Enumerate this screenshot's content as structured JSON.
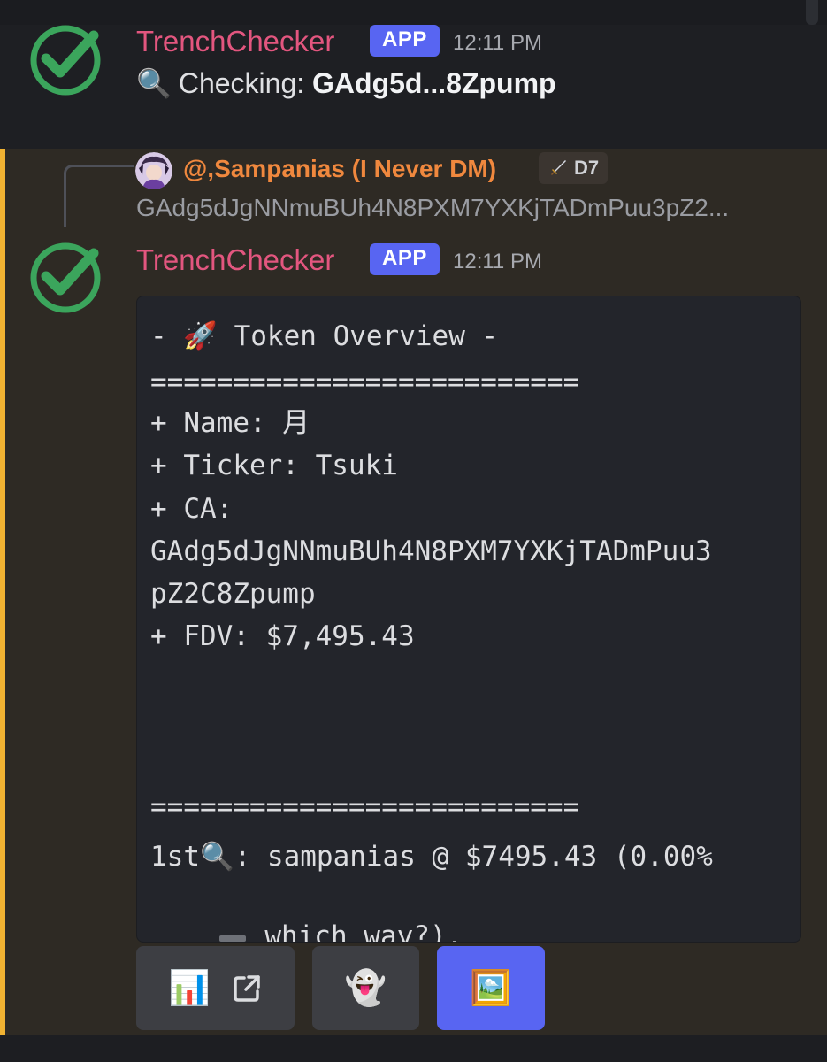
{
  "message1": {
    "username": "TrenchChecker",
    "badge": "APP",
    "time": "12:11 PM",
    "checking_label": "Checking:",
    "checking_value": "GAdg5d...8Zpump",
    "lens_emoji": "🔍"
  },
  "reply": {
    "username": "@,Sampanias (I Never DM)",
    "role_tag": "D7",
    "role_icon": "sword-icon",
    "preview": "GAdg5dJgNNmuBUh4N8PXM7YXKjTADmPuu3pZ2..."
  },
  "message2": {
    "username": "TrenchChecker",
    "badge": "APP",
    "time": "12:11 PM"
  },
  "code": {
    "line1": "- 🚀 Token Overview -",
    "divider": "==========================",
    "line_name": "+ Name: 月",
    "line_ticker": "+ Ticker: Tsuki",
    "line_ca": "+ CA:",
    "ca_part1": "GAdg5dJgNNmuBUh4N8PXM7YXKjTADmPuu3",
    "ca_part2": "pZ2C8Zpump",
    "line_fdv": "+ FDV: $7,495.43",
    "first_line": "1st🔍: sampanias @ $7495.43 (0.00%",
    "last_line": " which way?)."
  },
  "buttons": [
    {
      "icon": "bar-chart-icon",
      "emoji": "📊",
      "extra_icon": "external-link-icon"
    },
    {
      "icon": "ghost-icon",
      "emoji": "👻"
    },
    {
      "icon": "framed-picture-icon",
      "emoji": "🖼️"
    }
  ],
  "colors": {
    "username": "#e3567f",
    "badge": "#5865f2",
    "reply_name": "#f0883e",
    "highlight_bar": "#f0b232",
    "check_green": "#3ba55c"
  }
}
